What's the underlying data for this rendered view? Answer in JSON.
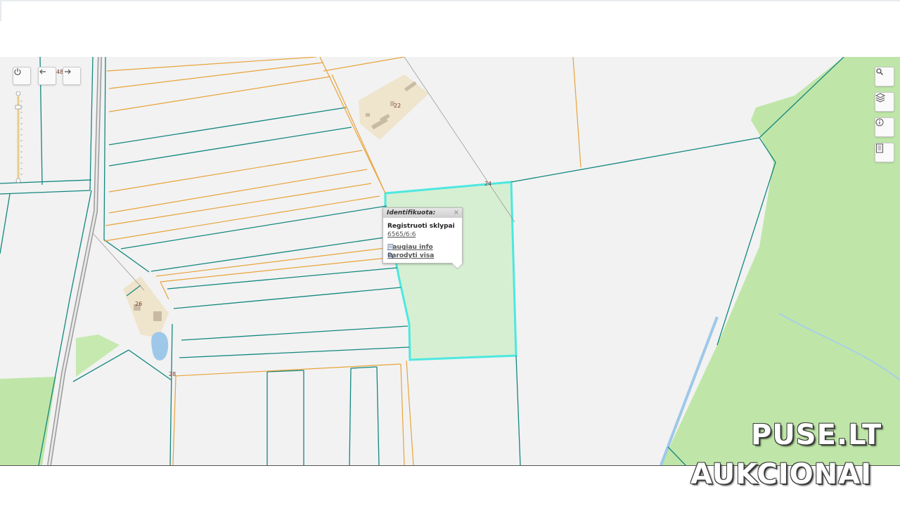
{
  "map": {
    "parcel_labels": [
      "22",
      "24",
      "26",
      "28",
      "48"
    ],
    "colors": {
      "background": "#f2f2f2",
      "forest": "#bfe6a8",
      "selected_fill": "#d6efd2",
      "selected_outline": "#4de8e0",
      "boundary_teal": "#13877f",
      "boundary_orange": "#e8a33a",
      "building_area": "#efe4cc",
      "water": "#9ec8ea"
    }
  },
  "controls": {
    "left": [
      "power-icon",
      "back-arrow-icon",
      "forward-arrow-icon"
    ],
    "right": [
      "search-icon",
      "layers-icon",
      "info-icon",
      "legend-icon"
    ]
  },
  "popup": {
    "title": "Identifikuota:",
    "close": "×",
    "layer": "Registruoti sklypai",
    "parcel_id": "6565/6:6",
    "more_info": "Daugiau info",
    "show_all": "Parodyti visa"
  },
  "watermark": {
    "line1": "PUSE.LT",
    "line2": "AUKCIONAI"
  }
}
